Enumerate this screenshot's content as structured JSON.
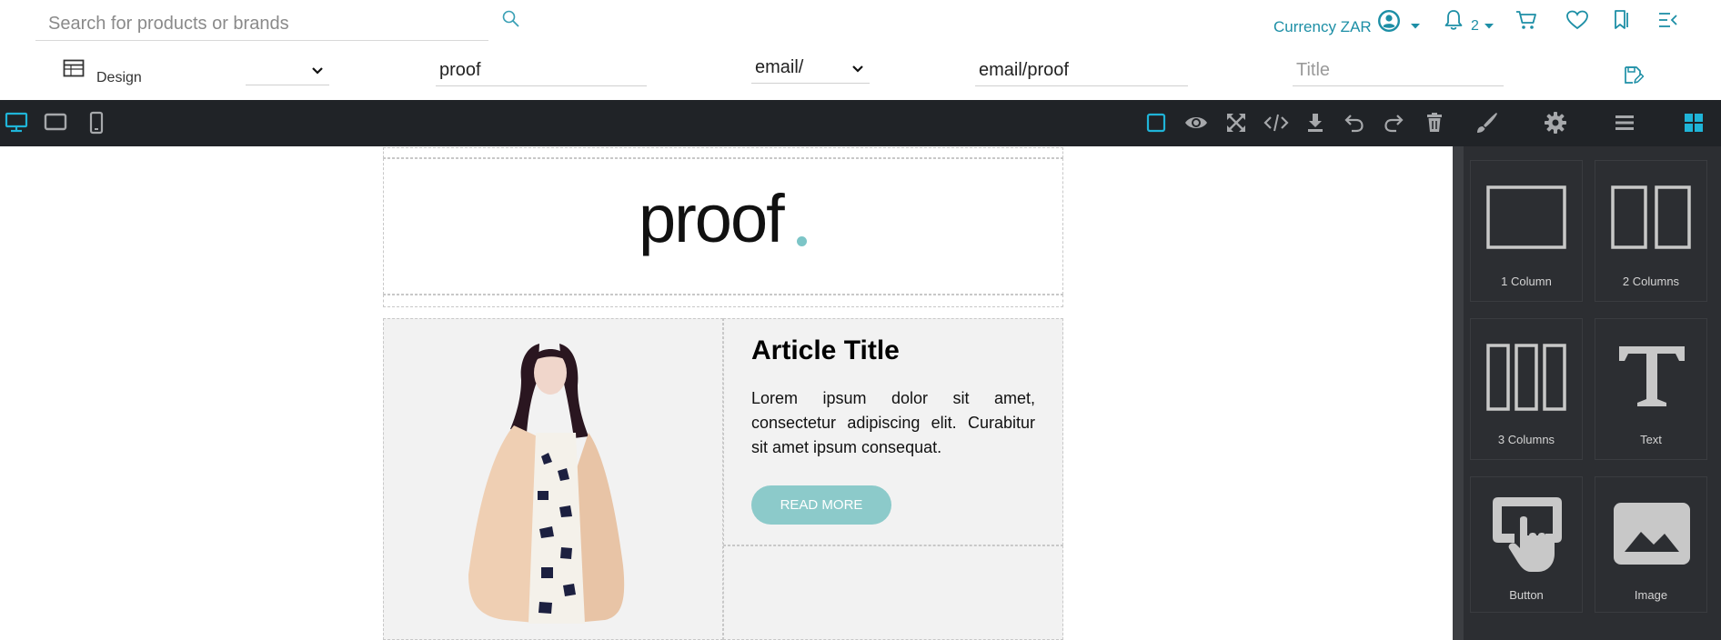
{
  "search": {
    "placeholder": "Search for products or brands"
  },
  "header": {
    "currency_label": "Currency ZAR",
    "notification_count": "2"
  },
  "meta_row": {
    "design_label": "Design",
    "select_1_value": "",
    "name_value": "proof",
    "path_prefix_value": "email/",
    "path_value": "email/proof",
    "title_placeholder": "Title"
  },
  "toolbar": {
    "devices": [
      "desktop",
      "tablet",
      "mobile"
    ],
    "active_device": "desktop",
    "actions": [
      "sw-visibility",
      "preview",
      "fullscreen",
      "export-code",
      "download",
      "undo",
      "redo",
      "clear-canvas"
    ],
    "panels": [
      "style-manager",
      "settings",
      "layer-manager",
      "blocks"
    ],
    "active_panel": "blocks",
    "accent_color": "#1fb4d8"
  },
  "email": {
    "logo_text": "proof",
    "logo_dot_color": "#7cc5c7",
    "article_title": "Article Title",
    "article_body": "Lorem ipsum dolor sit amet, consectetur adipiscing elit. Curabitur sit amet ipsum consequat.",
    "button_label": "READ MORE",
    "button_color": "#8ccaca"
  },
  "blocks": [
    {
      "label": "1 Column",
      "icon": "one-column-icon"
    },
    {
      "label": "2 Columns",
      "icon": "two-columns-icon"
    },
    {
      "label": "3 Columns",
      "icon": "three-columns-icon"
    },
    {
      "label": "Text",
      "icon": "text-icon"
    },
    {
      "label": "Button",
      "icon": "button-icon"
    },
    {
      "label": "Image",
      "icon": "image-icon"
    }
  ]
}
